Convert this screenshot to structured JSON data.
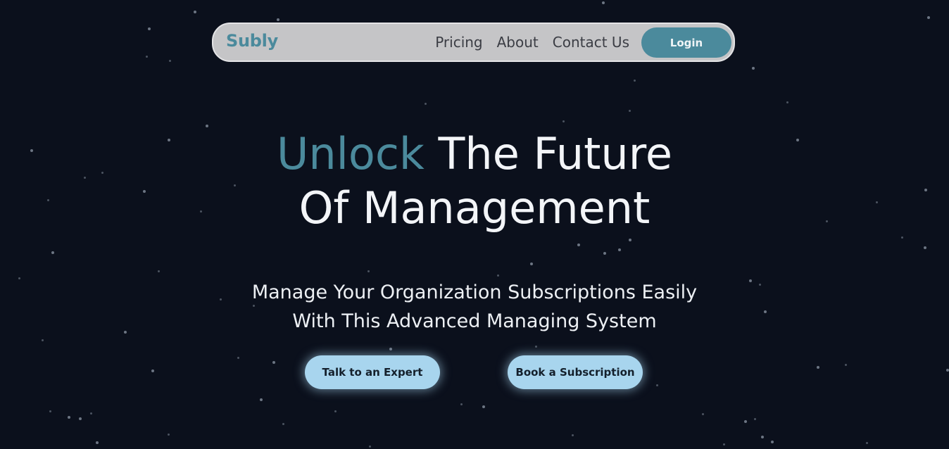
{
  "nav": {
    "brand": "Subly",
    "links": [
      "Pricing",
      "About",
      "Contact Us"
    ],
    "login_label": "Login"
  },
  "hero": {
    "title_accent": "Unlock",
    "title_rest_line1": "The Future",
    "title_line2": "Of Management",
    "subtitle_line1": "Manage Your Organization Subscriptions Easily",
    "subtitle_line2": "With This Advanced Managing System"
  },
  "cta": {
    "expert_label": "Talk to an Expert",
    "subscribe_label": "Book a Subscription"
  },
  "colors": {
    "background": "#0b101c",
    "accent": "#4b8a9c",
    "cta_fill": "#a8d5ee",
    "nav_fill": "#c5c5c7"
  }
}
